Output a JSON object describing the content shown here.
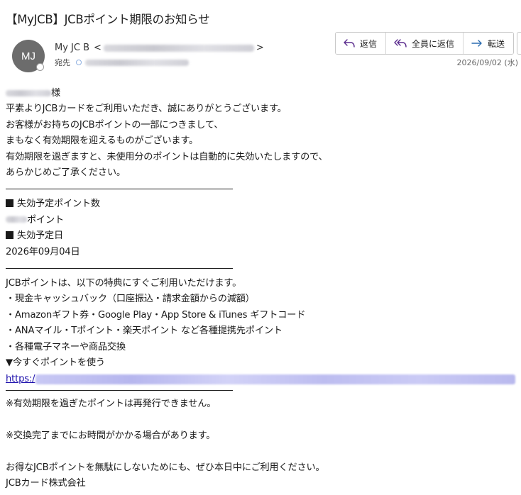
{
  "email": {
    "subject": "【MyJCB】JCBポイント期限のお知らせ",
    "sender": {
      "avatar_initials": "MJ",
      "name": "My JC B",
      "open_bracket": "<",
      "close_bracket": ">"
    },
    "recipient_label": "宛先",
    "date": "2026/09/02 (水)"
  },
  "actions": {
    "reply": "返信",
    "reply_all": "全員に返信",
    "forward": "転送"
  },
  "body": {
    "salutation_suffix": "様",
    "intro": [
      "平素よりJCBカードをご利用いただき、誠にありがとうございます。",
      "お客様がお持ちのJCBポイントの一部につきまして、",
      "まもなく有効期限を迎えるものがございます。",
      "有効期限を過ぎますと、未使用分のポイントは自動的に失効いたしますので、",
      "あらかじめご了承ください。"
    ],
    "points_heading": "失効予定ポイント数",
    "points_suffix": "ポイント",
    "date_heading": "失効予定日",
    "expiry_date": "2026年09月04日",
    "benefits_intro": "JCBポイントは、以下の特典にすぐご利用いただけます。",
    "benefits": [
      "・現金キャッシュバック（口座振込・請求金額からの減額）",
      "・Amazonギフト券・Google Play・App Store & iTunes ギフトコード",
      "・ANAマイル・Tポイント・楽天ポイント など各種提携先ポイント",
      "・各種電子マネーや商品交換"
    ],
    "cta": "▼今すぐポイントを使う",
    "link_prefix": "https:/",
    "note1": "※有効期限を過ぎたポイントは再発行できません。",
    "note2": "※交換完了までにお時間がかかる場合があります。",
    "closing": "お得なJCBポイントを無駄にしないためにも、ぜひ本日中にご利用ください。",
    "signature": "JCBカード株式会社"
  },
  "colors": {
    "avatar": "#6c6c6c",
    "link": "#1a0dab",
    "button_icon": "#5b2d8e"
  },
  "icons": {
    "reply": "reply-icon",
    "reply_all": "reply-all-icon",
    "forward": "forward-icon"
  }
}
